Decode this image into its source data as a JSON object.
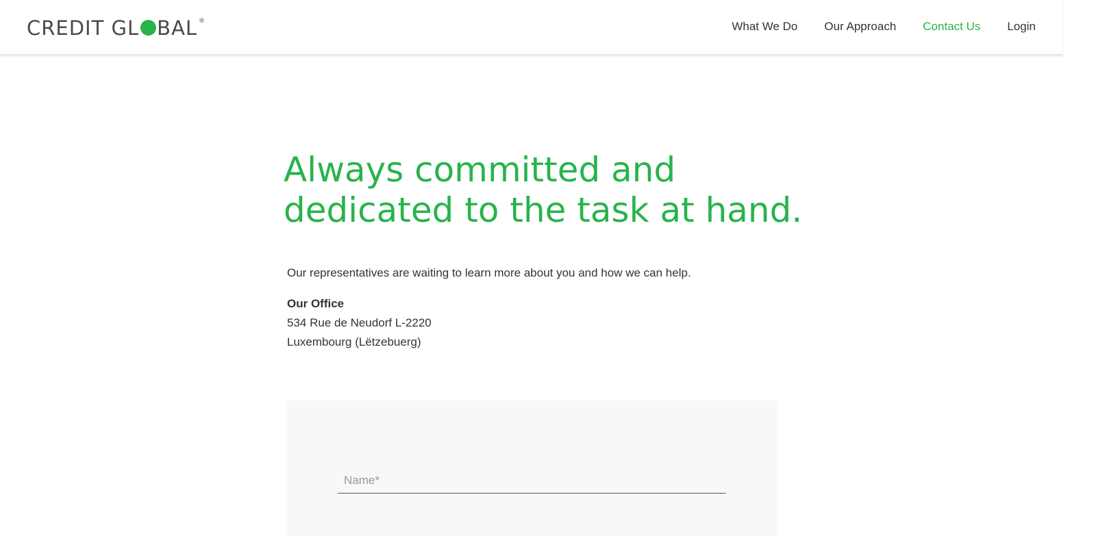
{
  "header": {
    "logo": {
      "text_before": "CREDIT GL",
      "text_after": "BAL",
      "registered_mark": "®",
      "accent_color": "#28b34b"
    },
    "nav": [
      {
        "label": "What We Do",
        "active": false
      },
      {
        "label": "Our Approach",
        "active": false
      },
      {
        "label": "Contact Us",
        "active": true
      },
      {
        "label": "Login",
        "active": false
      }
    ]
  },
  "hero": {
    "title_line1": "Always committed and",
    "title_line2": "dedicated to the task at hand.",
    "color": "#28b34b"
  },
  "intro": "Our representatives are waiting to learn more about you and how we can help.",
  "office": {
    "heading": "Our Office",
    "address_line1": "534 Rue de Neudorf L-2220",
    "address_line2": "Luxembourg (Lëtzebuerg)"
  },
  "form": {
    "name_field": {
      "placeholder": "Name*",
      "value": ""
    }
  }
}
